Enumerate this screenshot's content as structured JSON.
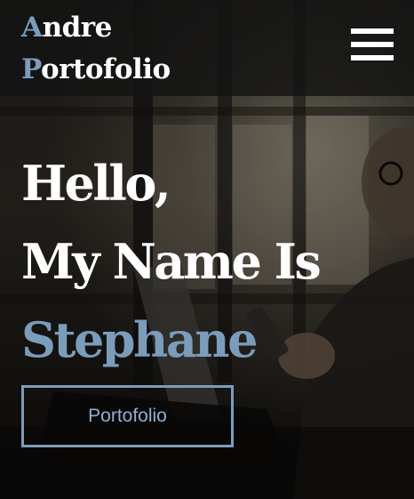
{
  "header": {
    "logo_initial_1": "A",
    "logo_rest_1": "ndre",
    "logo_initial_2": "P",
    "logo_rest_2": "ortofolio",
    "menu_icon": "hamburger-menu-icon"
  },
  "hero": {
    "greeting": "Hello,",
    "intro": "My Name Is",
    "name": "Stephane",
    "cta_label": "Portofolio",
    "background_image": "man with glasses using smartphone and laptop by window"
  },
  "colors": {
    "accent": "#7b9cbb",
    "text": "#ffffff",
    "header_bg": "#141414"
  }
}
